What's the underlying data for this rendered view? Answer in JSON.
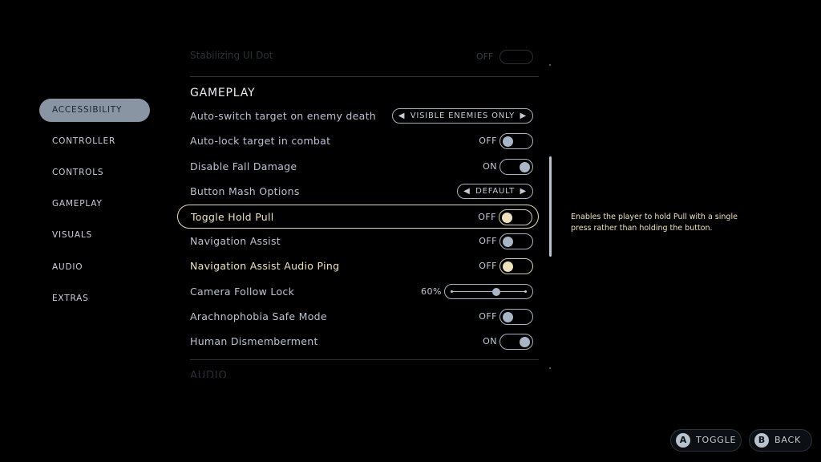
{
  "sidebar": {
    "items": [
      {
        "label": "ACCESSIBILITY",
        "active": true
      },
      {
        "label": "CONTROLLER"
      },
      {
        "label": "CONTROLS"
      },
      {
        "label": "GAMEPLAY"
      },
      {
        "label": "VISUALS"
      },
      {
        "label": "AUDIO"
      },
      {
        "label": "EXTRAS"
      }
    ]
  },
  "faded_top": {
    "label": "Stabilizing UI Dot",
    "value": "OFF"
  },
  "section": {
    "title": "GAMEPLAY"
  },
  "faded_bottom": {
    "title": "AUDIO"
  },
  "settings": [
    {
      "label": "Auto-switch target on enemy death",
      "type": "select",
      "value": "VISIBLE ENEMIES ONLY"
    },
    {
      "label": "Auto-lock target in combat",
      "type": "toggle",
      "value": "OFF"
    },
    {
      "label": "Disable Fall Damage",
      "type": "toggle",
      "value": "ON"
    },
    {
      "label": "Button Mash Options",
      "type": "select",
      "value": "DEFAULT"
    },
    {
      "label": "Toggle Hold Pull",
      "type": "toggle",
      "value": "OFF",
      "selected": true
    },
    {
      "label": "Navigation Assist",
      "type": "toggle",
      "value": "OFF"
    },
    {
      "label": "Navigation Assist Audio Ping",
      "type": "toggle",
      "value": "OFF",
      "highlight": true
    },
    {
      "label": "Camera Follow Lock",
      "type": "slider",
      "value": "60%",
      "percent": 60
    },
    {
      "label": "Arachnophobia Safe Mode",
      "type": "toggle",
      "value": "OFF"
    },
    {
      "label": "Human Dismemberment",
      "type": "toggle",
      "value": "ON"
    }
  ],
  "description": "Enables the player to hold Pull with a single press rather than holding the button.",
  "footer": {
    "toggle": {
      "key": "A",
      "label": "TOGGLE"
    },
    "back": {
      "key": "B",
      "label": "BACK"
    }
  },
  "colors": {
    "highlight": "#e6dcab",
    "accent": "#8a95a3",
    "background": "#000000"
  }
}
